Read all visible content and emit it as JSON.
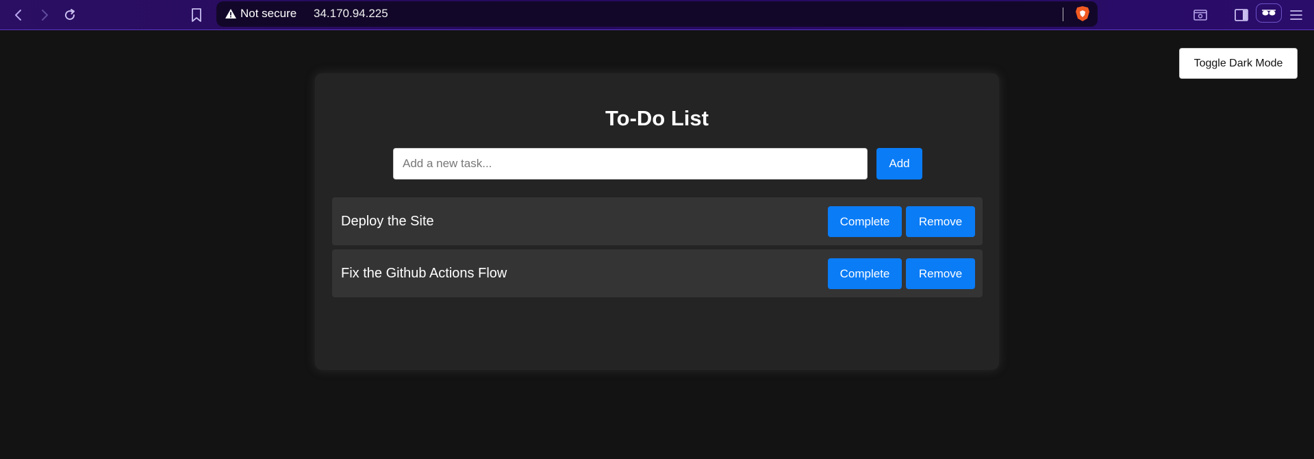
{
  "browser": {
    "security_label": "Not secure",
    "url": "34.170.94.225",
    "icons": [
      "back-icon",
      "forward-icon",
      "reload-icon",
      "bookmark-icon",
      "warning-icon",
      "brave-shields-icon",
      "screenshot-icon",
      "sidebar-icon",
      "vpn-icon",
      "menu-icon"
    ]
  },
  "page": {
    "toggle_label": "Toggle Dark Mode",
    "title": "To-Do List",
    "input": {
      "placeholder": "Add a new task...",
      "value": ""
    },
    "add_label": "Add",
    "tasks": [
      {
        "text": "Deploy the Site",
        "complete_label": "Complete",
        "remove_label": "Remove"
      },
      {
        "text": "Fix the Github Actions Flow",
        "complete_label": "Complete",
        "remove_label": "Remove"
      }
    ]
  },
  "colors": {
    "background": "#131313",
    "card": "#242424",
    "task_item": "#343434",
    "accent": "#0a7cf6",
    "toolbar": "#2b0f63"
  }
}
